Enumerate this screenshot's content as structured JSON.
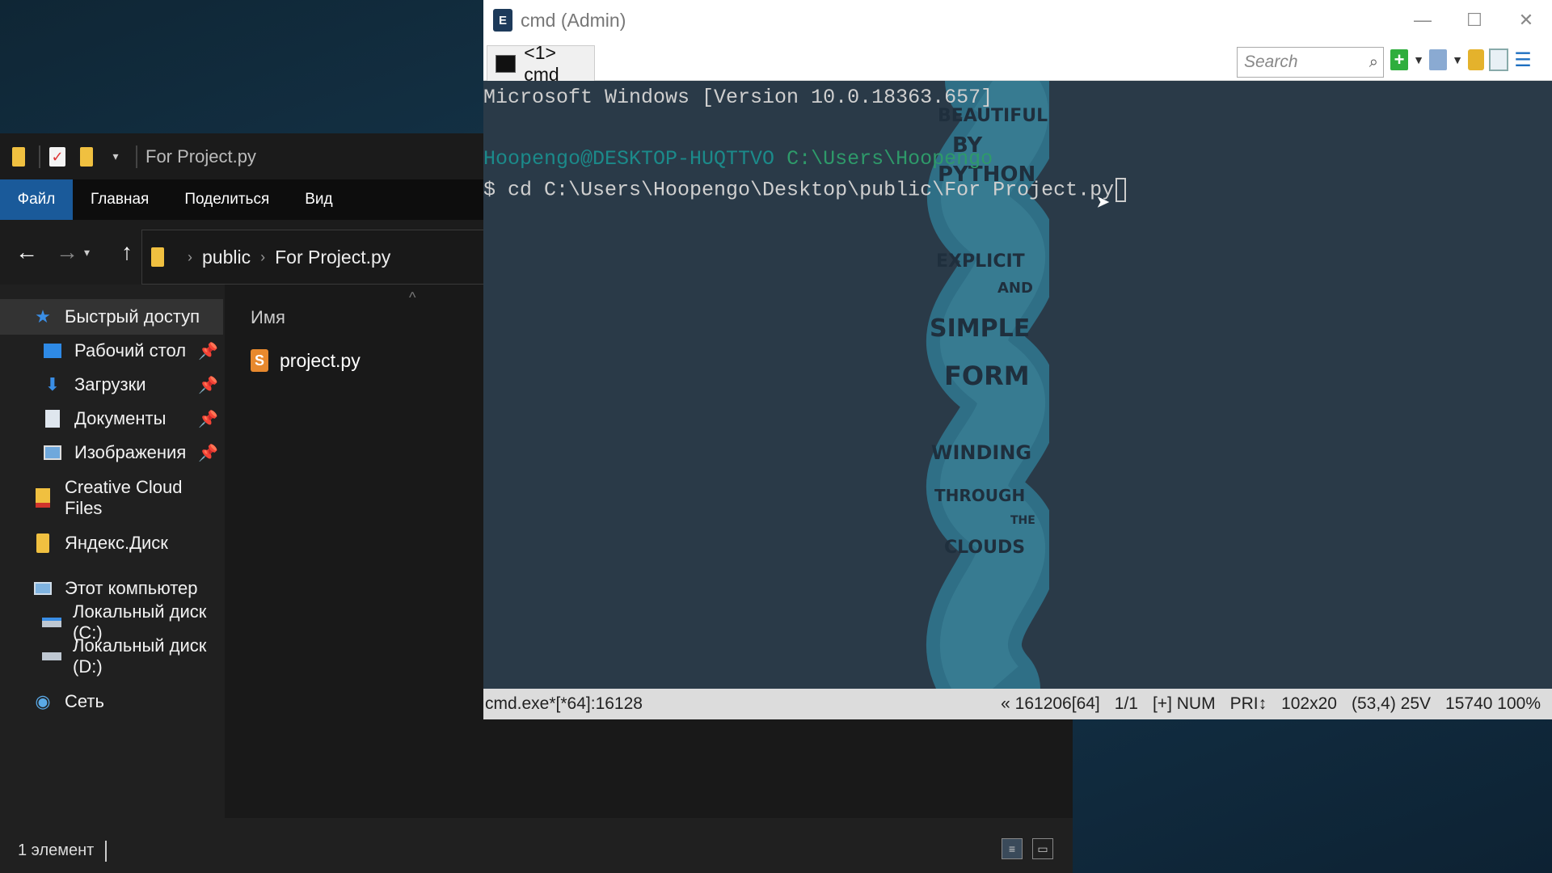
{
  "explorer": {
    "title": "For Project.py",
    "ribbon_tabs": [
      "Файл",
      "Главная",
      "Поделиться",
      "Вид"
    ],
    "breadcrumb": [
      "public",
      "For Project.py"
    ],
    "column_header": "Имя",
    "files": [
      {
        "name": "project.py",
        "icon": "sublime-text-icon"
      }
    ],
    "nav": {
      "quick_access": "Быстрый доступ",
      "desktop": "Рабочий стол",
      "downloads": "Загрузки",
      "documents": "Документы",
      "pictures": "Изображения",
      "creative_cloud": "Creative Cloud Files",
      "yandex_disk": "Яндекс.Диск",
      "this_pc": "Этот компьютер",
      "disk_c": "Локальный диск (C:)",
      "disk_d": "Локальный диск (D:)",
      "network": "Сеть"
    },
    "status": "1 элемент"
  },
  "conemu": {
    "title": "cmd (Admin)",
    "tab_label": "<1> cmd",
    "search_placeholder": "Search",
    "console": {
      "version_line": "Microsoft Windows [Version 10.0.18363.657]",
      "prompt_user": "Hoopengo@DESKTOP-HUQTTVO",
      "prompt_path": "C:\\Users\\Hoopengo",
      "command": "$ cd C:\\Users\\Hoopengo\\Desktop\\public\\For Project.py",
      "wallpaper_words": [
        "BEAUTIFUL",
        "BY",
        "PYTHON",
        "EXPLICIT",
        "AND",
        "SIMPLE",
        "FORM",
        "WINDING",
        "THROUGH",
        "THE",
        "CLOUDS"
      ]
    },
    "status": {
      "process": "cmd.exe*[*64]:16128",
      "pos": "« 161206[64]",
      "pages": "1/1",
      "mode": "[+] NUM",
      "pri": "PRI↕",
      "size": "102x20",
      "cursor": "(53,4) 25V",
      "mem": "15740 100%"
    }
  },
  "colors": {
    "console_bg": "#2a3a48",
    "prompt_user": "#1b8a8a",
    "prompt_path": "#2e9a6a",
    "ribbon_active": "#1a5a9a"
  }
}
